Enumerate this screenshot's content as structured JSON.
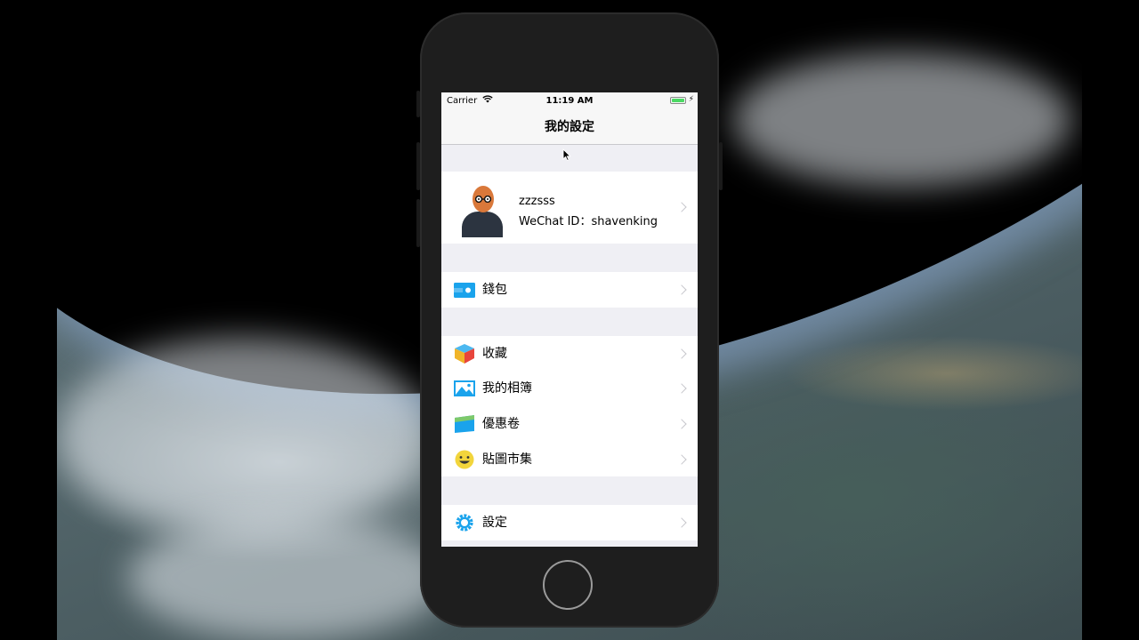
{
  "status_bar": {
    "carrier": "Carrier",
    "time": "11:19 AM"
  },
  "nav": {
    "title": "我的設定"
  },
  "profile": {
    "name": "zzzsss",
    "wechat_id": "WeChat ID：shavenking"
  },
  "sections": [
    {
      "items": [
        {
          "label": "錢包",
          "icon": "wallet-icon"
        }
      ]
    },
    {
      "items": [
        {
          "label": "收藏",
          "icon": "cube-icon"
        },
        {
          "label": "我的相簿",
          "icon": "photo-icon"
        },
        {
          "label": "優惠卷",
          "icon": "card-icon"
        },
        {
          "label": "貼圖市集",
          "icon": "smiley-icon"
        }
      ]
    },
    {
      "items": [
        {
          "label": "設定",
          "icon": "gear-icon"
        }
      ]
    }
  ],
  "colors": {
    "accent": "#1aa3ec",
    "battery": "#4cd964",
    "group_background": "#efeff4"
  }
}
